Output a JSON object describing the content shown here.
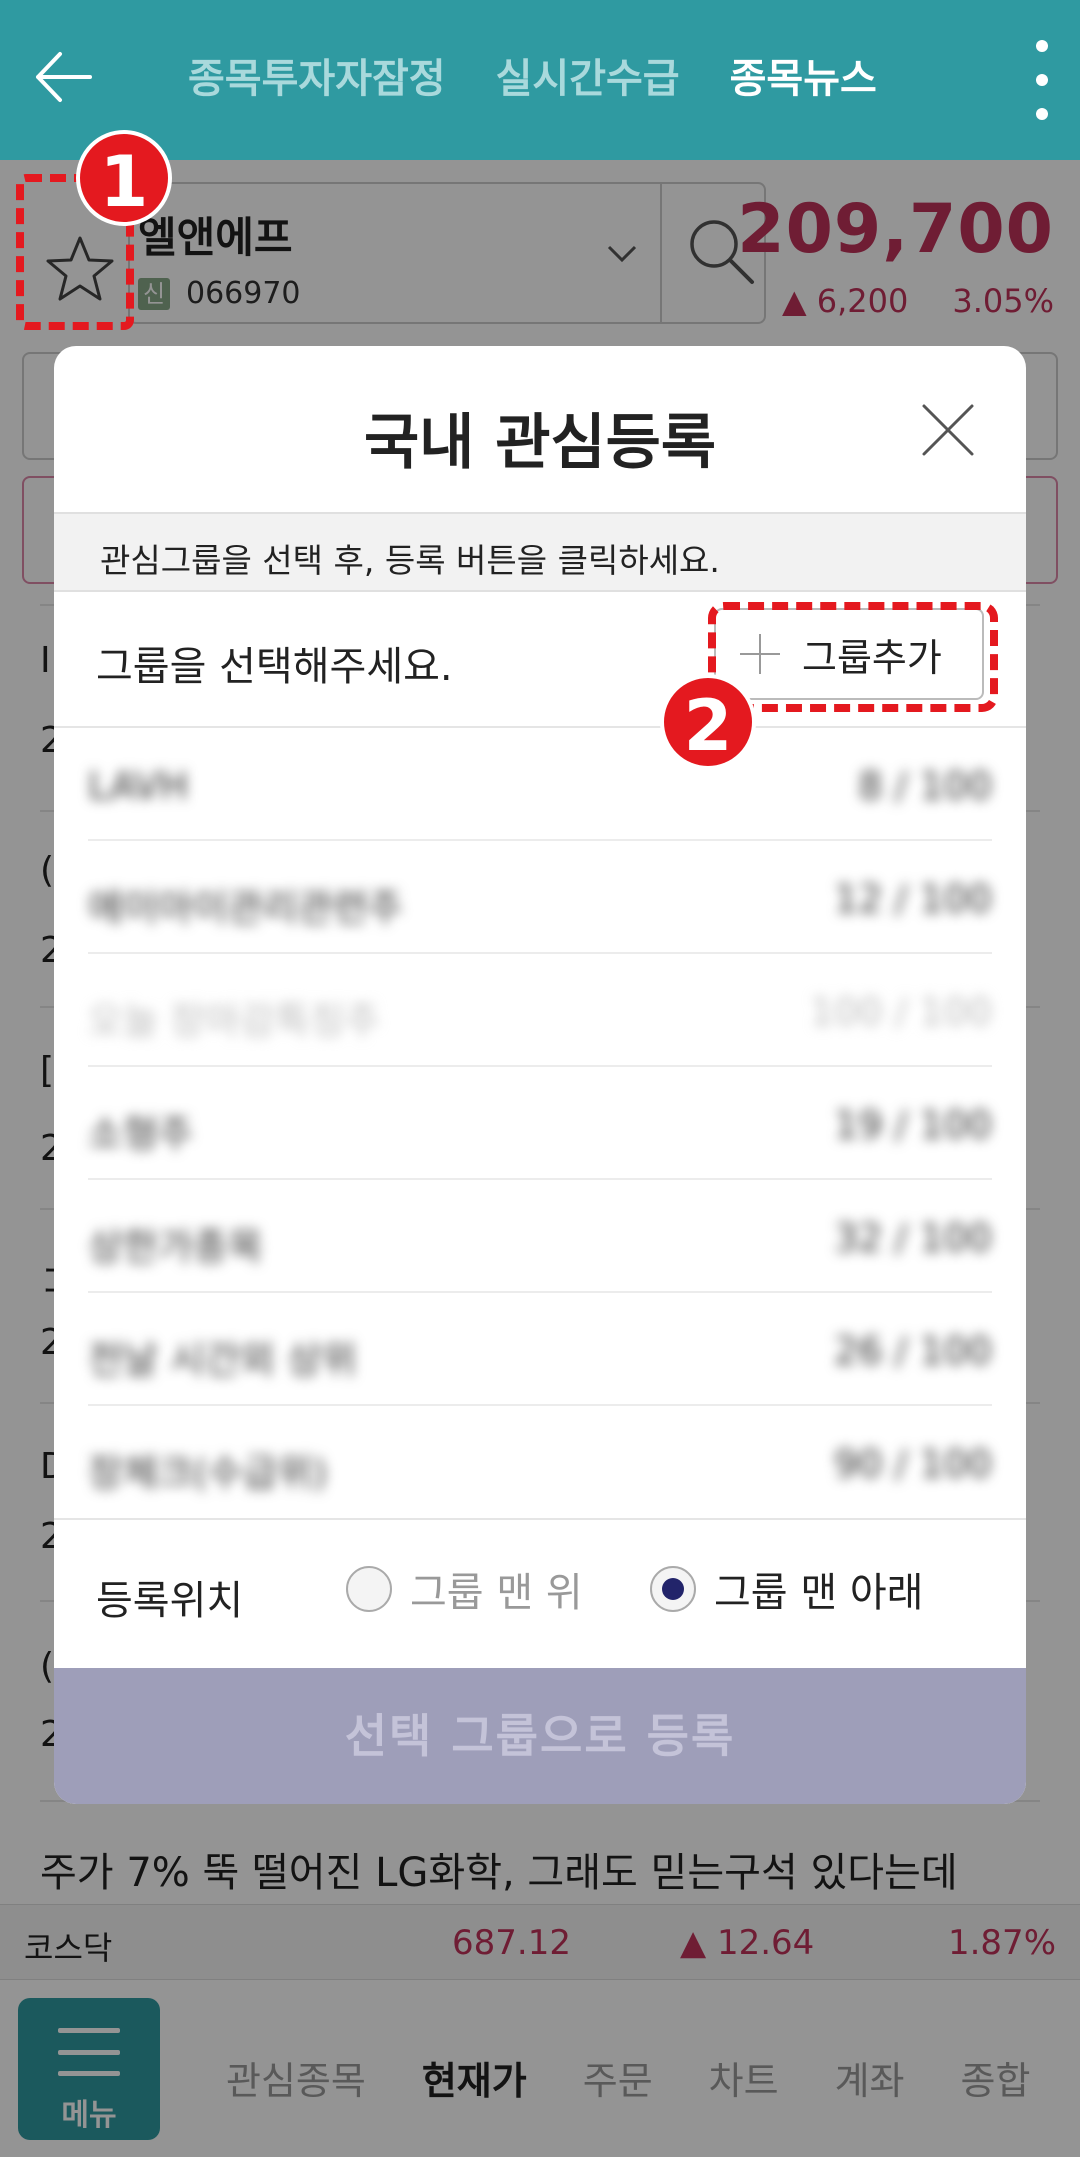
{
  "header": {
    "tabs": [
      {
        "label": "종목투자자잠정"
      },
      {
        "label": "실시간수급"
      },
      {
        "label": "종목뉴스"
      }
    ]
  },
  "stock": {
    "name": "엘앤에프",
    "market_badge": "신",
    "code": "066970",
    "price": "209,700",
    "change": "▲ 6,200",
    "change_pct": "3.05%"
  },
  "underlying": {
    "news_fragments": [
      "Ⅰ",
      "2",
      "(",
      "2",
      "[",
      "2",
      "コ",
      "2",
      "D",
      "2",
      "(",
      "2"
    ],
    "news_title": "주가 7% 뚝 떨어진 LG화학, 그래도 믿는구석 있다는데"
  },
  "index": {
    "name": "코스닥",
    "value": "687.12",
    "change": "▲ 12.64",
    "change_pct": "1.87%"
  },
  "bottom_nav": {
    "menu_label": "메뉴",
    "items": [
      {
        "label": "관심종목"
      },
      {
        "label": "현재가"
      },
      {
        "label": "주문"
      },
      {
        "label": "차트"
      },
      {
        "label": "계좌"
      },
      {
        "label": "종합"
      }
    ]
  },
  "modal": {
    "title": "국내 관심등록",
    "info": "관심그룹을 선택 후, 등록 버튼을 클릭하세요.",
    "group_prompt": "그룹을 선택해주세요.",
    "add_group_label": "그룹추가",
    "groups": [
      {
        "name": "LAVH",
        "count": "8 / 100"
      },
      {
        "name": "에이아이관리관련주",
        "count": "12 / 100"
      },
      {
        "name": "오늘 장마감특징주",
        "count": "100 / 100"
      },
      {
        "name": "소형주",
        "count": "19 / 100"
      },
      {
        "name": "상한가종목",
        "count": "32 / 100"
      },
      {
        "name": "전날 시간외 상위",
        "count": "26 / 100"
      },
      {
        "name": "장체크(수급위)",
        "count": "90 / 100"
      }
    ],
    "position_label": "등록위치",
    "option_top": "그룹 맨 위",
    "option_bottom": "그룹 맨 아래",
    "selected_option": "그룹 맨 아래",
    "submit_label": "선택 그룹으로 등록"
  },
  "annotations": {
    "step1": "1",
    "step2": "2"
  },
  "colors": {
    "header_bg": "#2f9aa1",
    "price_red": "#c0325a",
    "annotation_red": "#e4191f",
    "submit_bg": "#9e9eb9"
  }
}
